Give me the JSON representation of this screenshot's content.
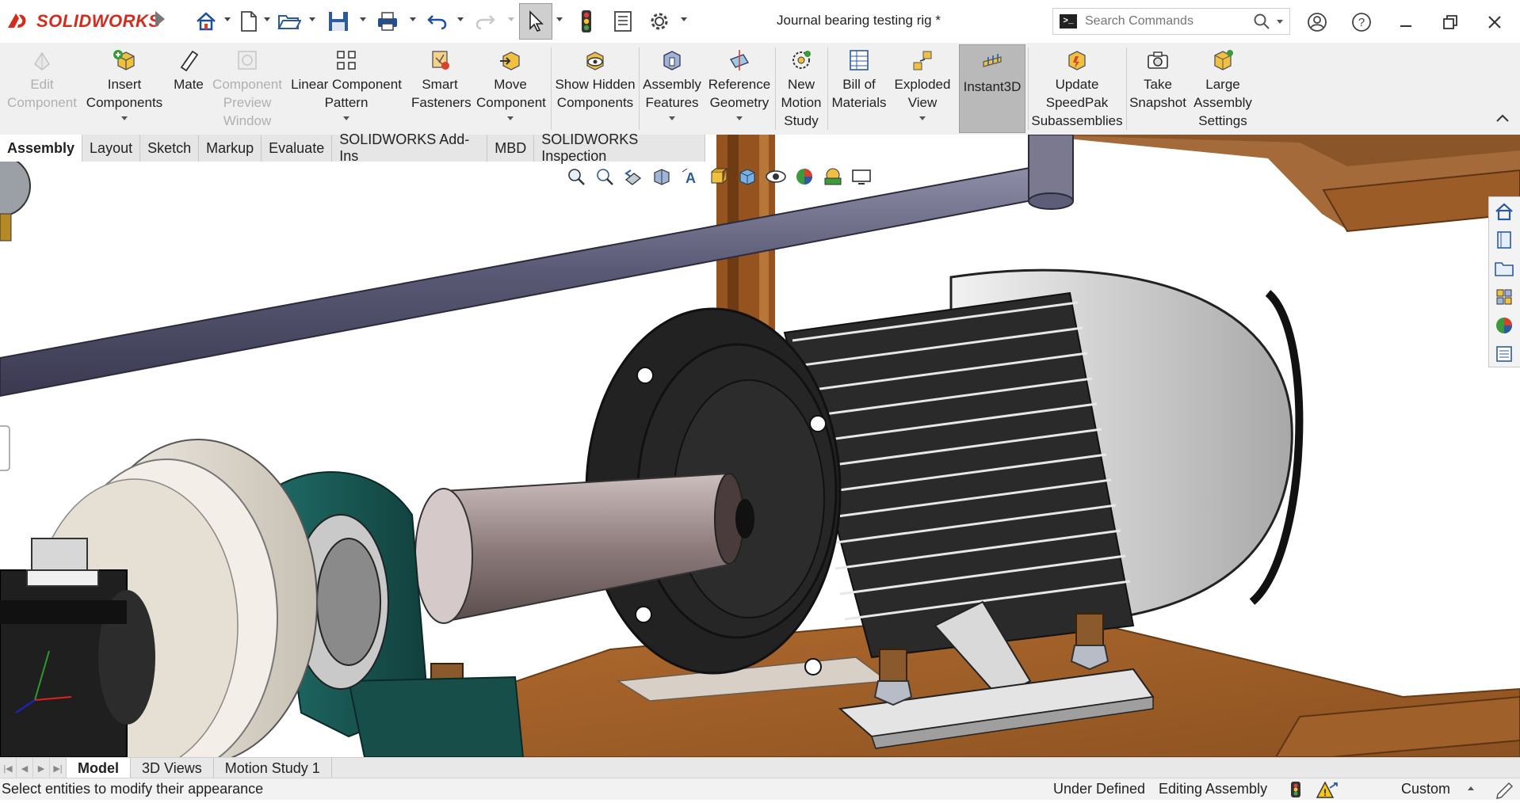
{
  "app": {
    "brand": "SOLIDWORKS",
    "document_title": "Journal bearing testing rig *"
  },
  "search": {
    "placeholder": "Search Commands"
  },
  "ribbon": {
    "buttons": [
      {
        "label": "Edit Component",
        "disabled": true,
        "icon": "edit-component-icon"
      },
      {
        "label": "Insert Components",
        "dropdown": true,
        "icon": "insert-components-icon"
      },
      {
        "label": "Mate",
        "icon": "mate-icon"
      },
      {
        "label": "Component Preview Window",
        "disabled": true,
        "icon": "preview-window-icon"
      },
      {
        "label": "Linear Component Pattern",
        "dropdown": true,
        "icon": "linear-pattern-icon"
      },
      {
        "label": "Smart Fasteners",
        "icon": "smart-fasteners-icon"
      },
      {
        "label": "Move Component",
        "dropdown": true,
        "icon": "move-component-icon"
      },
      {
        "label": "Show Hidden Components",
        "icon": "show-hidden-icon"
      },
      {
        "label": "Assembly Features",
        "dropdown": true,
        "icon": "assembly-features-icon"
      },
      {
        "label": "Reference Geometry",
        "dropdown": true,
        "icon": "reference-geometry-icon"
      },
      {
        "label": "New Motion Study",
        "icon": "motion-study-icon"
      },
      {
        "label": "Bill of Materials",
        "icon": "bom-icon"
      },
      {
        "label": "Exploded View",
        "dropdown": true,
        "icon": "exploded-view-icon"
      },
      {
        "label": "Instant3D",
        "active": true,
        "icon": "instant3d-icon"
      },
      {
        "label": "Update SpeedPak Subassemblies",
        "icon": "speedpak-icon"
      },
      {
        "label": "Take Snapshot",
        "icon": "camera-icon"
      },
      {
        "label": "Large Assembly Settings",
        "icon": "large-assembly-icon"
      }
    ]
  },
  "tabs": [
    "Assembly",
    "Layout",
    "Sketch",
    "Markup",
    "Evaluate",
    "SOLIDWORKS Add-Ins",
    "MBD",
    "SOLIDWORKS Inspection"
  ],
  "active_tab": "Assembly",
  "bottom_tabs": [
    "Model",
    "3D Views",
    "Motion Study 1"
  ],
  "active_bottom_tab": "Model",
  "status": {
    "message": "Select entities to modify their appearance",
    "definition": "Under Defined",
    "mode": "Editing Assembly",
    "units": "Custom"
  },
  "colors": {
    "accent_red": "#d52b1e",
    "ribbon_bg": "#f0f0f0",
    "frame_wood": "#9a5a26",
    "motor_body": "#2a2a2a",
    "bearing_housing": "#1d5e5a"
  }
}
